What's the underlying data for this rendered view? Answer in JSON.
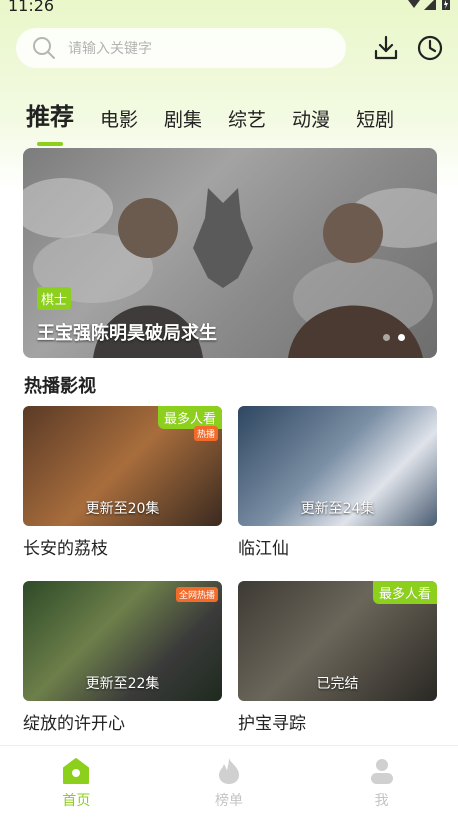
{
  "status_bar": {
    "time": "11:26"
  },
  "search": {
    "placeholder": "请输入关键字"
  },
  "tabs": [
    "推荐",
    "电影",
    "剧集",
    "综艺",
    "动漫",
    "短剧"
  ],
  "banner": {
    "tag": "棋士",
    "title": "王宝强陈明昊破局求生"
  },
  "section": {
    "title": "热播影视"
  },
  "cards": [
    {
      "name": "长安的荔枝",
      "episode": "更新至20集",
      "badge": "最多人看",
      "hot": "热播"
    },
    {
      "name": "临江仙",
      "episode": "更新至24集"
    },
    {
      "name": "绽放的许开心",
      "episode": "更新至22集",
      "hot": "全网热播"
    },
    {
      "name": "护宝寻踪",
      "episode": "已完结",
      "badge": "最多人看"
    }
  ],
  "nav": [
    {
      "label": "首页"
    },
    {
      "label": "榜单"
    },
    {
      "label": "我"
    }
  ],
  "colors": {
    "accent": "#8ccf1c",
    "inactive": "#c4c4c4"
  }
}
